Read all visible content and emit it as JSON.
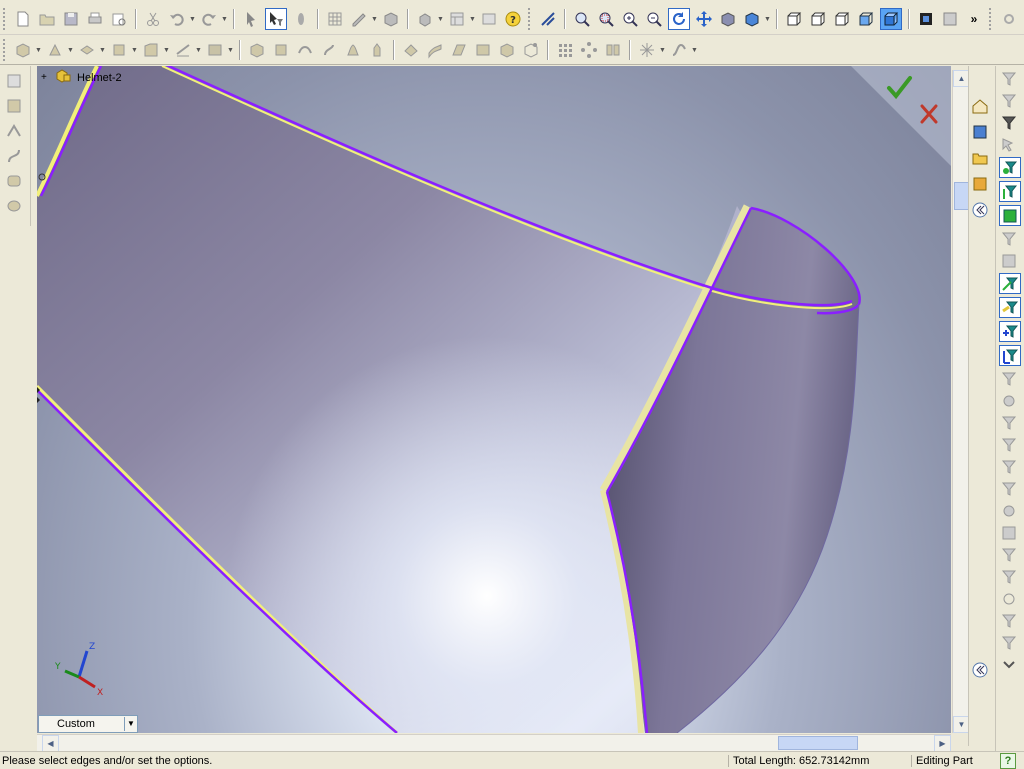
{
  "feature_tree": {
    "expander": "+",
    "root_label": "Helmet-2"
  },
  "view_orientation": {
    "selected": "Custom"
  },
  "triad": {
    "x": "X",
    "y": "Y",
    "z": "Z"
  },
  "status_bar": {
    "message": "Please select edges and/or set the options.",
    "total_length": "Total Length: 652.73142mm",
    "mode": "Editing Part",
    "help": "?"
  },
  "toolbar_top_icons": [
    "new-icon",
    "open-icon",
    "save-icon",
    "print-icon",
    "print-preview-icon",
    "cut-icon",
    "undo-icon",
    "redo-icon",
    "select-icon",
    "select-filter-icon",
    "3d-pointer-icon",
    "grid-icon",
    "sketch-icon",
    "component-icon",
    "options-icon",
    "help-icon",
    "section-icon",
    "zoom-fit-icon",
    "zoom-area-icon",
    "zoom-in-icon",
    "zoom-out-icon",
    "rotate-icon",
    "pan-icon",
    "shaded-icon",
    "display-style-icon",
    "front-view-icon",
    "back-view-icon",
    "left-view-icon",
    "right-view-icon",
    "iso-view-icon",
    "wireframe-icon",
    "hidden-lines-icon"
  ],
  "toolbar_second_icons": [
    "extrude-icon",
    "revolve-icon",
    "sweep-icon",
    "loft-icon",
    "fillet-icon",
    "chamfer-icon",
    "shell-icon",
    "rib-icon",
    "draft-icon",
    "hole-icon",
    "mirror-icon",
    "pattern-icon",
    "surface-extrude-icon",
    "surface-revolve-icon",
    "surface-sweep-icon",
    "surface-loft-icon",
    "boundary-surface-icon",
    "offset-surface-icon",
    "knit-icon",
    "thicken-icon",
    "linear-pattern-icon",
    "circular-pattern-icon",
    "fill-pattern-icon",
    "reference-point-icon",
    "curve-icon"
  ],
  "colors": {
    "accept": "#3a9a26",
    "cancel": "#c0392b",
    "selected_edge": "#8a1fff",
    "edge_highlight": "#f2ef7a",
    "surface_dark": "#5f5a78",
    "surface_light": "#9b98b2"
  }
}
